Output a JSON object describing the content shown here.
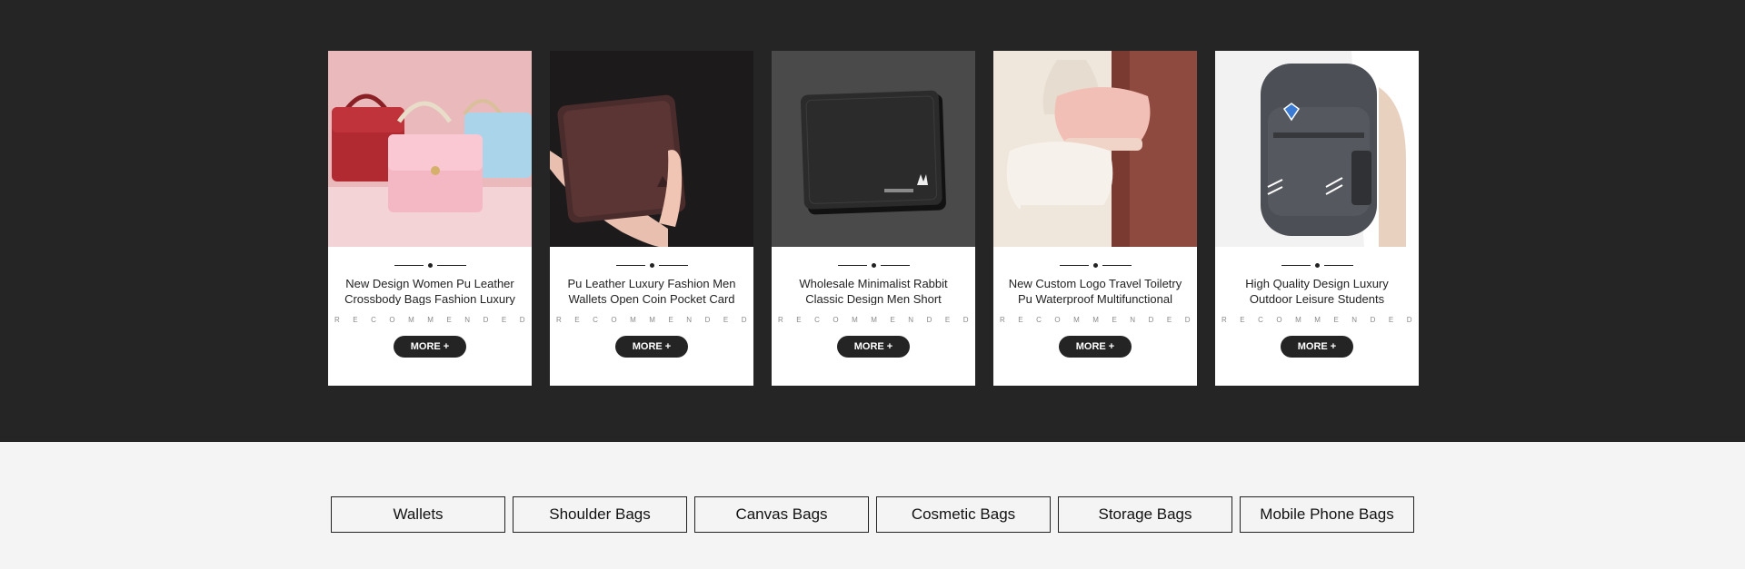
{
  "products": [
    {
      "title": "New Design Women Pu Leather Crossbody Bags Fashion Luxury",
      "recommended": "RECOMMENDED",
      "button": "MORE +",
      "image": "colorful-handbags"
    },
    {
      "title": "Pu Leather Luxury Fashion Men Wallets Open Coin Pocket Card",
      "recommended": "RECOMMENDED",
      "button": "MORE +",
      "image": "brown-wallet-in-hand"
    },
    {
      "title": "Wholesale Minimalist Rabbit Classic Design Men Short",
      "recommended": "RECOMMENDED",
      "button": "MORE +",
      "image": "black-bifold-wallet"
    },
    {
      "title": "New Custom Logo Travel Toiletry Pu Waterproof Multifunctional",
      "recommended": "RECOMMENDED",
      "button": "MORE +",
      "image": "pink-cosmetic-pouch"
    },
    {
      "title": "High Quality Design Luxury Outdoor Leisure Students",
      "recommended": "RECOMMENDED",
      "button": "MORE +",
      "image": "grey-backpack"
    }
  ],
  "categories": [
    "Wallets",
    "Shoulder Bags",
    "Canvas Bags",
    "Cosmetic Bags",
    "Storage Bags",
    "Mobile Phone Bags"
  ],
  "colors": {
    "dark_band": "#252525",
    "light_band": "#f4f4f4",
    "button": "#242424"
  }
}
